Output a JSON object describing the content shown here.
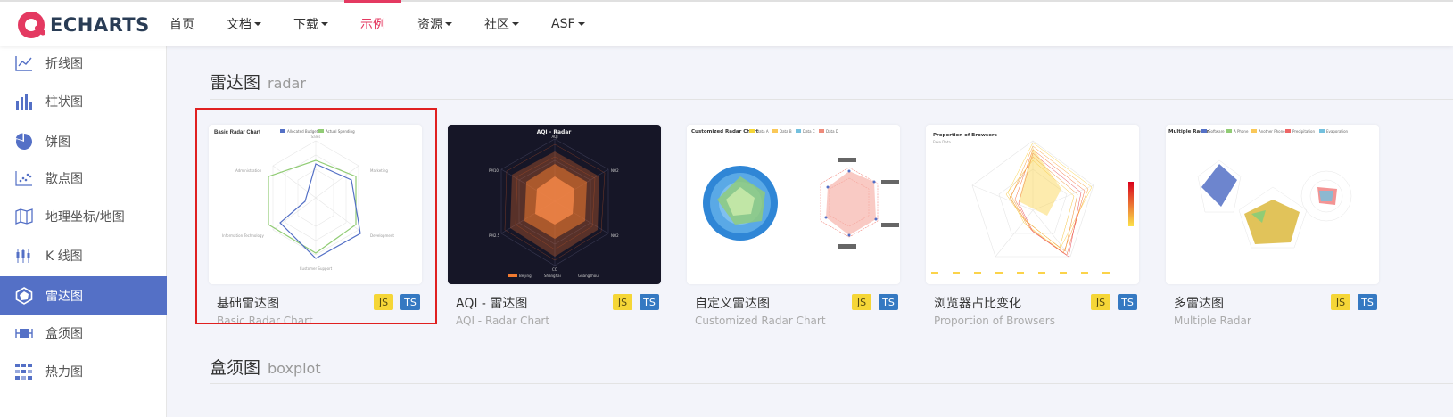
{
  "logo": {
    "text": "ECHARTS"
  },
  "nav": [
    {
      "label": "首页",
      "dropdown": false,
      "active": false
    },
    {
      "label": "文档",
      "dropdown": true,
      "active": false
    },
    {
      "label": "下载",
      "dropdown": true,
      "active": false
    },
    {
      "label": "示例",
      "dropdown": false,
      "active": true
    },
    {
      "label": "资源",
      "dropdown": true,
      "active": false
    },
    {
      "label": "社区",
      "dropdown": true,
      "active": false
    },
    {
      "label": "ASF",
      "dropdown": true,
      "active": false
    }
  ],
  "sidebar": {
    "items": [
      {
        "label": "折线图",
        "icon": "line-chart-icon"
      },
      {
        "label": "柱状图",
        "icon": "bar-chart-icon"
      },
      {
        "label": "饼图",
        "icon": "pie-chart-icon"
      },
      {
        "label": "散点图",
        "icon": "scatter-chart-icon"
      },
      {
        "label": "地理坐标/地图",
        "icon": "map-icon"
      },
      {
        "label": "K 线图",
        "icon": "candlestick-icon"
      },
      {
        "label": "雷达图",
        "icon": "radar-chart-icon",
        "active": true
      },
      {
        "label": "盒须图",
        "icon": "boxplot-icon"
      },
      {
        "label": "热力图",
        "icon": "heatmap-icon"
      }
    ]
  },
  "sections": {
    "radar": {
      "title": "雷达图",
      "title_en": "radar"
    },
    "boxplot": {
      "title": "盒须图",
      "title_en": "boxplot"
    }
  },
  "cards": [
    {
      "title": "基础雷达图",
      "subtitle": "Basic Radar Chart",
      "thumb_title": "Basic Radar Chart",
      "legend": [
        "Allocated Budget",
        "Actual Spending"
      ],
      "axes": [
        "Sales",
        "Marketing",
        "Development",
        "Customer Support",
        "Information Technology",
        "Administration"
      ],
      "js": "JS",
      "ts": "TS",
      "selected": true
    },
    {
      "title": "AQI - 雷达图",
      "subtitle": "AQI - Radar Chart",
      "thumb_title": "AQI - Radar",
      "axes": [
        "AQI",
        "NO2",
        "NO2",
        "CO",
        "PM10",
        "PM2.5"
      ],
      "legend": [
        "Beijing",
        "Shanghai",
        "Guangzhou"
      ],
      "js": "JS",
      "ts": "TS"
    },
    {
      "title": "自定义雷达图",
      "subtitle": "Customized Radar Chart",
      "thumb_title": "Customized Radar Chart",
      "legend": [
        "Data A",
        "Data B",
        "Data C",
        "Data D"
      ],
      "js": "JS",
      "ts": "TS"
    },
    {
      "title": "浏览器占比变化",
      "subtitle": "Proportion of Browsers",
      "thumb_title": "Proportion of Browsers",
      "thumb_sub": "Fake Data",
      "js": "JS",
      "ts": "TS"
    },
    {
      "title": "多雷达图",
      "subtitle": "Multiple Radar",
      "thumb_title": "Multiple Radar",
      "legend": [
        "Software",
        "A Phone",
        "Another Phone",
        "Precipitation",
        "Evaporation"
      ],
      "js": "JS",
      "ts": "TS"
    }
  ],
  "colors": {
    "accent": "#e43961",
    "primary": "#5470c6",
    "js": "#f5d637",
    "ts": "#3579c2"
  }
}
